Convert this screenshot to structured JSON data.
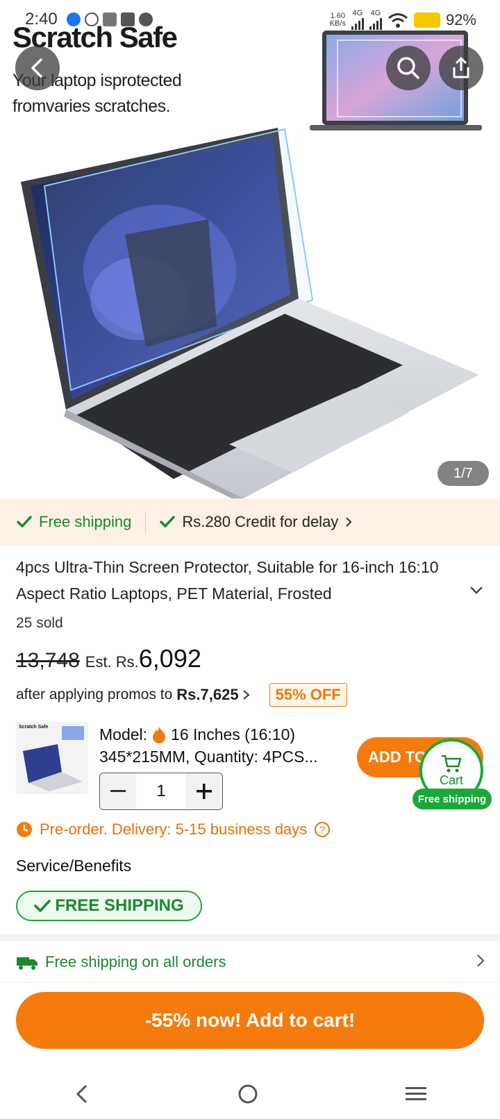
{
  "status_bar": {
    "time": "2:40",
    "net_speed": "1.60",
    "net_unit": "KB/s",
    "net1": "4G",
    "net2": "4G",
    "battery": "92%"
  },
  "hero": {
    "brand": "Scratch Safe",
    "tagline_line1": "Your laptop isprotected",
    "tagline_line2": "fromvaries scratches.",
    "counter": "1/7"
  },
  "shipping_strip": {
    "free_shipping": "Free shipping",
    "credit": "Rs.280 Credit for delay"
  },
  "product": {
    "title": "4pcs Ultra-Thin Screen Protector, Suitable for 16-inch 16:10 Aspect Ratio Laptops, PET Material, Frosted",
    "sold": "25 sold",
    "old_price": "13,748",
    "est_label": "Est. Rs.",
    "new_price": "6,092",
    "promo_text": "after applying promos to",
    "promo_price": "Rs.7,625",
    "discount_badge": "55% OFF"
  },
  "model": {
    "thumb_brand": "Scratch Safe",
    "label": "Model:",
    "value_line1": "16 Inches (16:10)",
    "value_line2": "345*215MM, Quantity: 4PCS...",
    "quantity": "1",
    "add_button": "ADD TO",
    "cart_label": "Cart",
    "cart_badge": "Free shipping"
  },
  "delivery": {
    "preorder": "Pre-order. Delivery: 5-15 business days"
  },
  "service": {
    "heading": "Service/Benefits",
    "free_badge": "FREE SHIPPING",
    "all_orders": "Free shipping on all orders"
  },
  "cta": {
    "label": "-55% now! Add to cart!"
  },
  "colors": {
    "accent_orange": "#f57c0c",
    "green": "#1aa83a",
    "strip_bg": "#fdf0e4"
  }
}
